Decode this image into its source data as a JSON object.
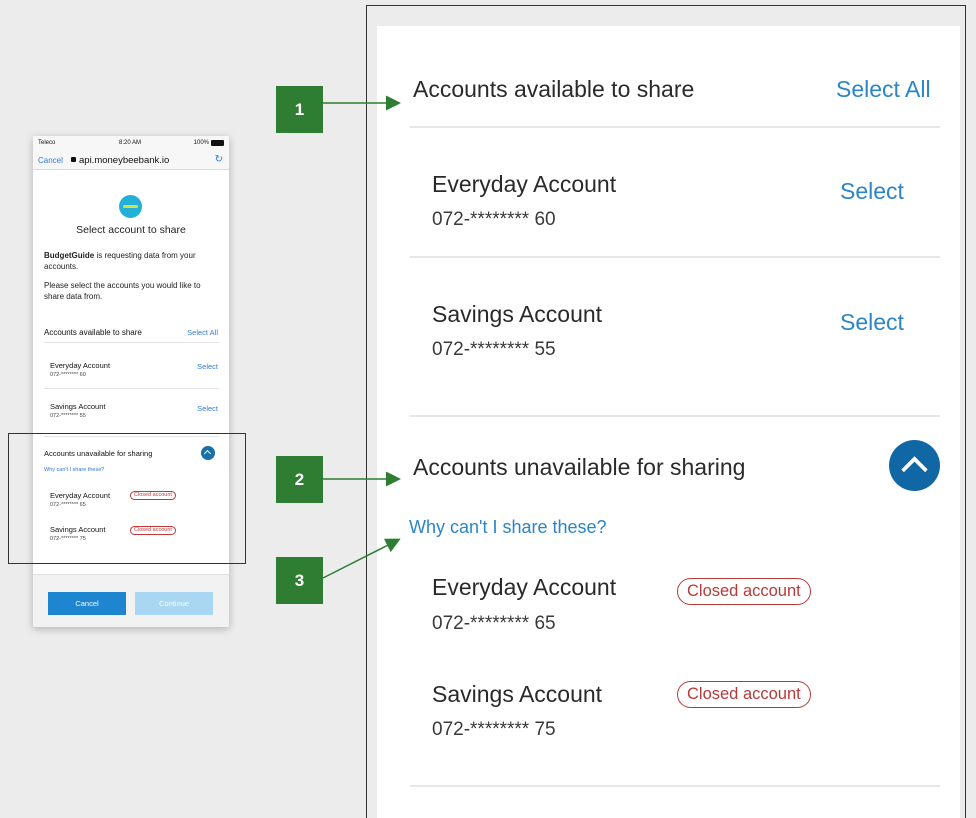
{
  "phone": {
    "status": {
      "carrier": "Teleco",
      "time": "8:20 AM",
      "battery": "100%"
    },
    "url_bar": {
      "cancel": "Cancel",
      "url": "api.moneybeebank.io",
      "reload_icon": "reload-icon"
    },
    "title": "Select account to share",
    "requester": "BudgetGuide",
    "request_text": " is requesting data from your accounts.",
    "instruction": "Please select the accounts you would like to share data from.",
    "available": {
      "heading": "Accounts available to share",
      "select_all": "Select All",
      "accounts": [
        {
          "name": "Everyday Account",
          "number": "072-******** 60",
          "action": "Select"
        },
        {
          "name": "Savings Account",
          "number": "072-******** 55",
          "action": "Select"
        }
      ]
    },
    "unavailable": {
      "heading": "Accounts unavailable for sharing",
      "why": "Why can't I share these?",
      "accounts": [
        {
          "name": "Everyday Account",
          "number": "072-******** 65",
          "badge": "Closed account"
        },
        {
          "name": "Savings Account",
          "number": "072-******** 75",
          "badge": "Closed account"
        }
      ]
    },
    "buttons": {
      "cancel": "Cancel",
      "continue": "Continue"
    }
  },
  "callouts": [
    "1",
    "2",
    "3"
  ],
  "zoom": {
    "available_heading": "Accounts available to share",
    "select_all": "Select All",
    "accounts": [
      {
        "name": "Everyday Account",
        "number": "072-******** 60",
        "action": "Select"
      },
      {
        "name": "Savings Account",
        "number": "072-******** 55",
        "action": "Select"
      }
    ],
    "unavailable_heading": "Accounts unavailable for sharing",
    "why": "Why can't I share these?",
    "unavailable_accounts": [
      {
        "name": "Everyday Account",
        "number": "072-******** 65",
        "badge": "Closed account"
      },
      {
        "name": "Savings Account",
        "number": "072-******** 75",
        "badge": "Closed account"
      }
    ]
  },
  "colors": {
    "accent": "#2b85c7",
    "callout": "#2e7d32",
    "badge": "#b53a3a",
    "chevron": "#1167a3"
  }
}
